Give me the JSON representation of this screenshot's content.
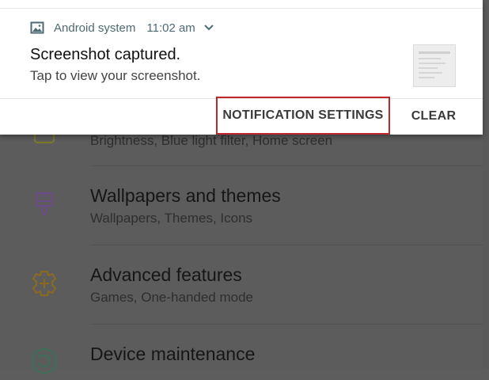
{
  "notification": {
    "app_name": "Android system",
    "time": "11:02 am",
    "title": "Screenshot captured.",
    "text": "Tap to view your screenshot.",
    "actions": {
      "settings": "NOTIFICATION SETTINGS",
      "clear": "CLEAR"
    },
    "icon": "image-icon"
  },
  "settings_list": [
    {
      "title": "",
      "subtitle": "Brightness, Blue light filter, Home screen",
      "icon": "display-icon",
      "icon_color": "#7a7a2a"
    },
    {
      "title": "Wallpapers and themes",
      "subtitle": "Wallpapers, Themes, Icons",
      "icon": "paintbrush-icon",
      "icon_color": "#6b4e86"
    },
    {
      "title": "Advanced features",
      "subtitle": "Games, One-handed mode",
      "icon": "gear-plus-icon",
      "icon_color": "#8a6a1e"
    },
    {
      "title": "Device maintenance",
      "subtitle": "",
      "icon": "refresh-circle-icon",
      "icon_color": "#3f6e5a"
    }
  ],
  "colors": {
    "highlight_border": "#c0272d",
    "dim_background": "#5c5c5c"
  }
}
